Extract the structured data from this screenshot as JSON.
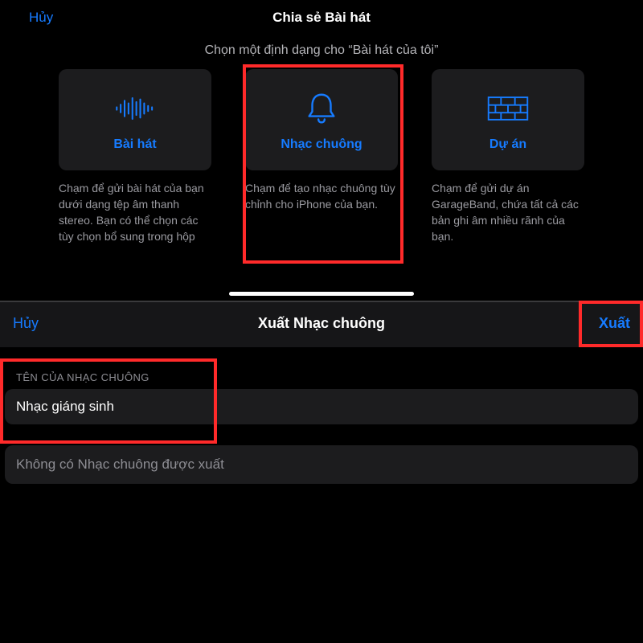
{
  "top": {
    "cancel": "Hủy",
    "title": "Chia sẻ Bài hát",
    "subtitle": "Chọn một định dạng cho “Bài hát của tôi”",
    "options": [
      {
        "icon": "waveform-icon",
        "label": "Bài hát",
        "desc": "Chạm để gửi bài hát của bạn dưới dạng tệp âm thanh stereo. Bạn có thể chọn các tùy chọn bổ sung trong hộp"
      },
      {
        "icon": "bell-icon",
        "label": "Nhạc chuông",
        "desc": "Chạm để tạo nhạc chuông tùy chỉnh cho iPhone của bạn."
      },
      {
        "icon": "bricks-icon",
        "label": "Dự án",
        "desc": "Chạm để gửi dự án GarageBand, chứa tất cả các bản ghi âm nhiều rãnh của bạn."
      }
    ]
  },
  "bottom": {
    "cancel": "Hủy",
    "title": "Xuất Nhạc chuông",
    "export": "Xuất",
    "section_label": "TÊN CỦA NHẠC CHUÔNG",
    "name_value": "Nhạc giáng sinh",
    "status": "Không có Nhạc chuông được xuất"
  },
  "colors": {
    "accent": "#167bff",
    "highlight": "#ff2a2a"
  }
}
